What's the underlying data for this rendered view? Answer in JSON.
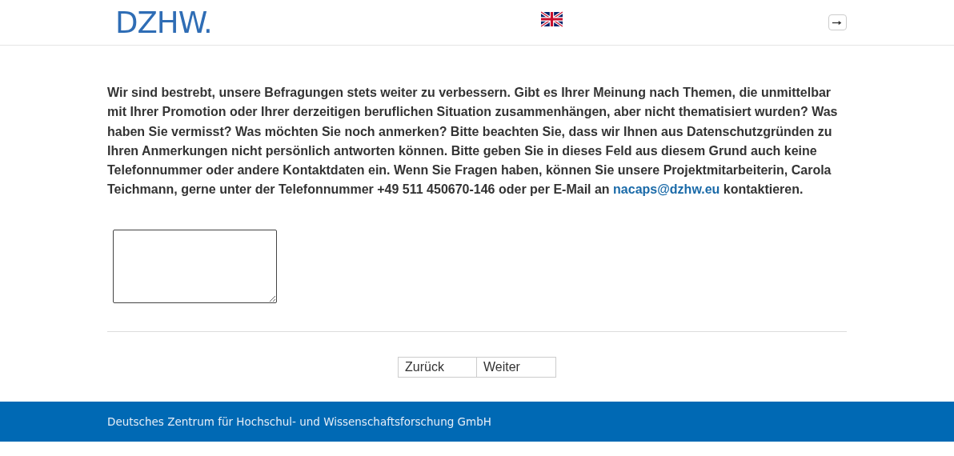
{
  "header": {
    "logo": "DZHW.",
    "language": {
      "kind": "uk-flag"
    },
    "logout": {
      "kind": "exit"
    }
  },
  "question": {
    "text_before": "Wir sind bestrebt, unsere Befragungen stets weiter zu verbessern. Gibt es Ihrer Meinung nach Themen, die unmittelbar mit Ihrer Promotion oder Ihrer derzeitigen beruflichen Situation zusammenhängen, aber nicht thematisiert wurden? Was haben Sie vermisst? Was möchten Sie noch anmerken? Bitte beachten Sie, dass wir Ihnen aus Datenschutzgründen zu Ihren Anmerkungen nicht persönlich antworten können. Bitte geben Sie in dieses Feld aus diesem Grund auch keine Telefonnummer oder andere Kontaktdaten ein. Wenn Sie Fragen haben, können Sie unsere Projektmitarbeiterin, Carola Teichmann, gerne unter der Telefonnummer +49 511 450670-146 oder per E-Mail an",
    "link": "nacaps@dzhw.eu",
    "text_after": "kontaktieren."
  },
  "buttons": [
    "Zurück",
    "Weiter"
  ],
  "footer": "Deutsches Zentrum für Hochschul- und Wissenschaftsforschung GmbH"
}
